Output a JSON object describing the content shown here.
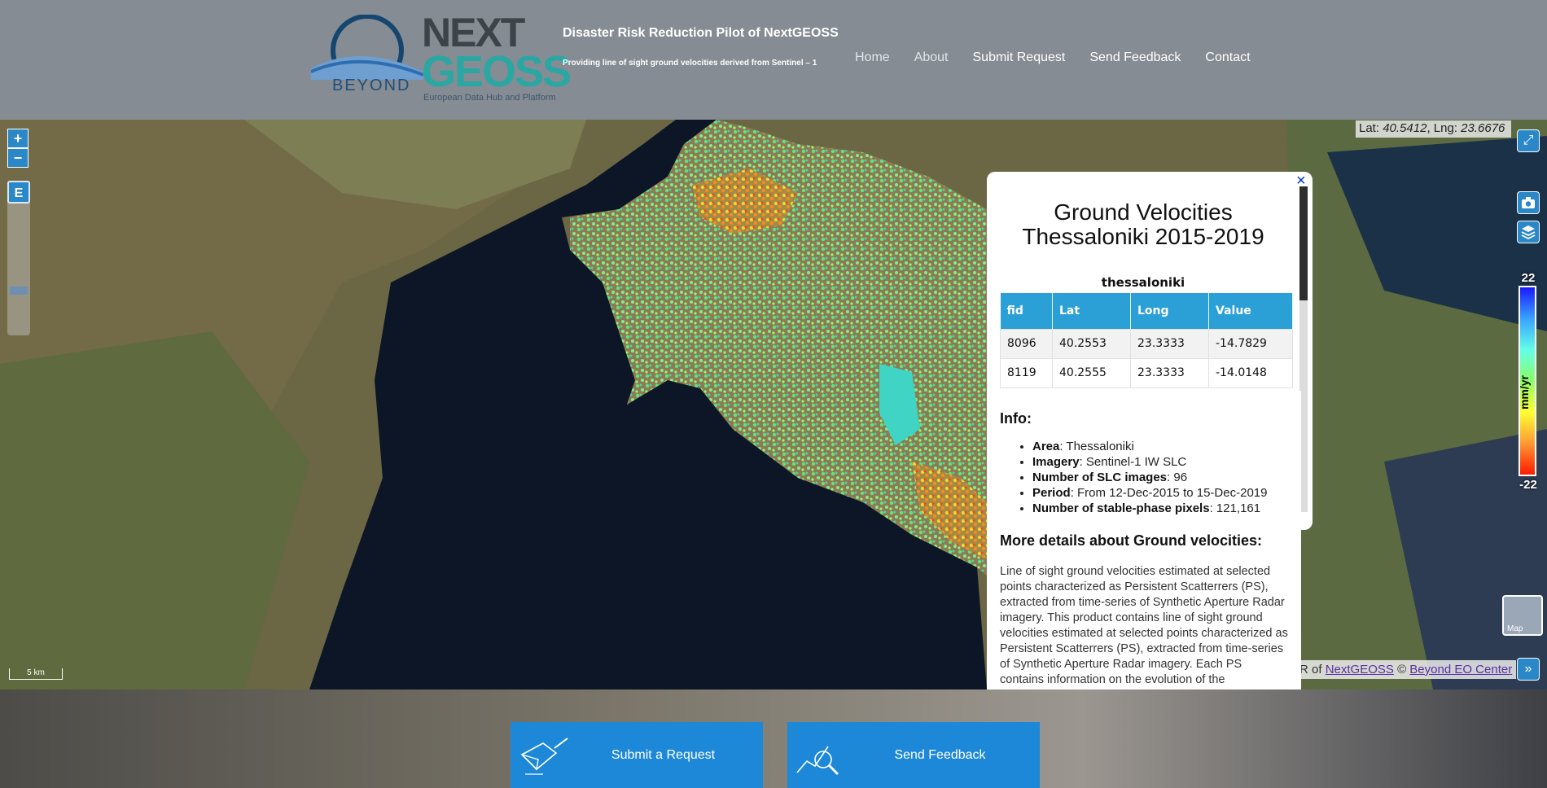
{
  "header": {
    "logo_beyond": "BEYOND",
    "logo_next": "NEXT",
    "logo_geoss": "GEOSS",
    "logo_sub": "European Data Hub and Platform",
    "title": "Disaster Risk Reduction Pilot of NextGEOSS",
    "subtitle": "Providing line of sight ground velocities derived from Sentinel – 1",
    "nav": [
      "Home",
      "About",
      "Submit Request",
      "Send Feedback",
      "Contact"
    ]
  },
  "map": {
    "zoom_in": "+",
    "zoom_out": "−",
    "layer_button": "E",
    "coords_lat_label": "Lat:",
    "coords_lat": "40.5412",
    "coords_lng_label": "Lng:",
    "coords_lng": "23.6676",
    "legend_max": "22",
    "legend_min": "-22",
    "legend_unit": "mm/yr",
    "minimap_label": "Map",
    "attribution_prefix": "R of",
    "attribution_link1": "NextGEOSS",
    "attribution_sep": "©",
    "attribution_link2": "Beyond EO Center",
    "scale_label": "5 km",
    "colors": {
      "legend_top": "#1a1aff",
      "legend_bottom": "#ff1a00"
    }
  },
  "popup": {
    "close": "×",
    "title_line1": "Ground Velocities",
    "title_line2": "Thessaloniki 2015-2019",
    "table_caption": "thessaloniki",
    "columns": [
      "fid",
      "Lat",
      "Long",
      "Value"
    ],
    "rows": [
      [
        "8096",
        "40.2553",
        "23.3333",
        "-14.7829"
      ],
      [
        "8119",
        "40.2555",
        "23.3333",
        "-14.0148"
      ]
    ]
  },
  "info": {
    "heading": "Info:",
    "items": [
      {
        "key": "Area",
        "value": ": Thessaloniki"
      },
      {
        "key": "Imagery",
        "value": ": Sentinel-1 IW SLC"
      },
      {
        "key": "Number of SLC images",
        "value": ": 96"
      },
      {
        "key": "Period",
        "value": ": From 12-Dec-2015 to 15-Dec-2019"
      },
      {
        "key": "Number of stable-phase pixels",
        "value": ": 121,161"
      }
    ],
    "details_heading": "More details about Ground velocities:",
    "details_text": "Line of sight ground velocities estimated at selected points characterized as Persistent Scatterrers (PS), extracted from time-series of Synthetic Aperture Radar imagery. This product contains line of sight ground velocities estimated at selected points characterized as Persistent Scatterrers (PS), extracted from time-series of Synthetic Aperture Radar imagery. Each PS contains information on the evolution of the deformation during the observation time-span, a"
  },
  "bottom": {
    "submit_label": "Submit a Request",
    "feedback_label": "Send Feedback"
  }
}
